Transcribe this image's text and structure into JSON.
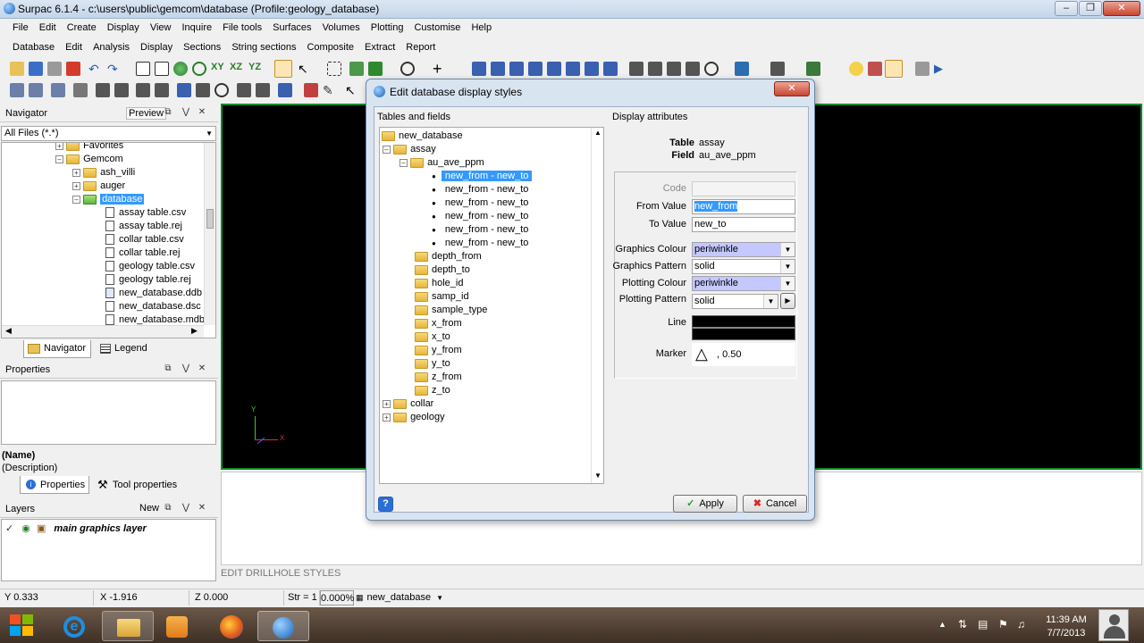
{
  "window": {
    "title": "Surpac 6.1.4 - c:\\users\\public\\gemcom\\database (Profile:geology_database)"
  },
  "menu1": [
    "File",
    "Edit",
    "Create",
    "Display",
    "View",
    "Inquire",
    "File tools",
    "Surfaces",
    "Volumes",
    "Plotting",
    "Customise",
    "Help"
  ],
  "menu2": [
    "Database",
    "Edit",
    "Analysis",
    "Display",
    "Sections",
    "String sections",
    "Composite",
    "Extract",
    "Report"
  ],
  "navigator": {
    "title": "Navigator",
    "preview": "Preview",
    "filter": "All Files (*.*)",
    "items": [
      "Favorites",
      "Gemcom",
      "ash_villi",
      "auger",
      "database",
      "assay table.csv",
      "assay table.rej",
      "collar table.csv",
      "collar table.rej",
      "geology table.csv",
      "geology table.rej",
      "new_database.ddb",
      "new_database.dsc",
      "new_database.mdb"
    ],
    "tabs": [
      "Navigator",
      "Legend"
    ]
  },
  "properties": {
    "title": "Properties",
    "name": "(Name)",
    "description": "(Description)",
    "tabs": [
      "Properties",
      "Tool properties"
    ]
  },
  "layers": {
    "title": "Layers",
    "new": "New",
    "item": "main graphics layer"
  },
  "dialog": {
    "title": "Edit database display styles",
    "left_label": "Tables and fields",
    "right_label": "Display attributes",
    "tree": {
      "root": "new_database",
      "assay": "assay",
      "field": "au_ave_ppm",
      "ranges": [
        "new_from  -  new_to",
        "new_from  -  new_to",
        "new_from  -  new_to",
        "new_from  -  new_to",
        "new_from  -  new_to",
        "new_from  -  new_to"
      ],
      "fields": [
        "depth_from",
        "depth_to",
        "hole_id",
        "samp_id",
        "sample_type",
        "x_from",
        "x_to",
        "y_from",
        "y_to",
        "z_from",
        "z_to"
      ],
      "tables": [
        "collar",
        "geology"
      ]
    },
    "attrs": {
      "table_label": "Table",
      "table_value": "assay",
      "field_label": "Field",
      "field_value": "au_ave_ppm",
      "code_label": "Code",
      "code_value": "",
      "from_label": "From Value",
      "from_value": "new_from",
      "to_label": "To Value",
      "to_value": "new_to",
      "gcolour_label": "Graphics Colour",
      "gcolour_value": "periwinkle",
      "gpattern_label": "Graphics Pattern",
      "gpattern_value": "solid",
      "pcolour_label": "Plotting Colour",
      "pcolour_value": "periwinkle",
      "ppattern_label": "Plotting Pattern",
      "ppattern_value": "solid",
      "line_label": "Line",
      "marker_label": "Marker",
      "marker_value": ", 0.50"
    },
    "apply": "Apply",
    "cancel": "Cancel",
    "periwinkle_color": "#c5c8ff"
  },
  "axis": {
    "y": "Y",
    "x": "X"
  },
  "message": "EDIT DRILLHOLE STYLES",
  "status": {
    "y": "Y  0.333",
    "x": "X  -1.916",
    "z": "Z  0.000",
    "str": "Str = 1",
    "pct": "0.000%",
    "db": "new_database"
  },
  "clock": {
    "time": "11:39 AM",
    "date": "7/7/2013"
  }
}
